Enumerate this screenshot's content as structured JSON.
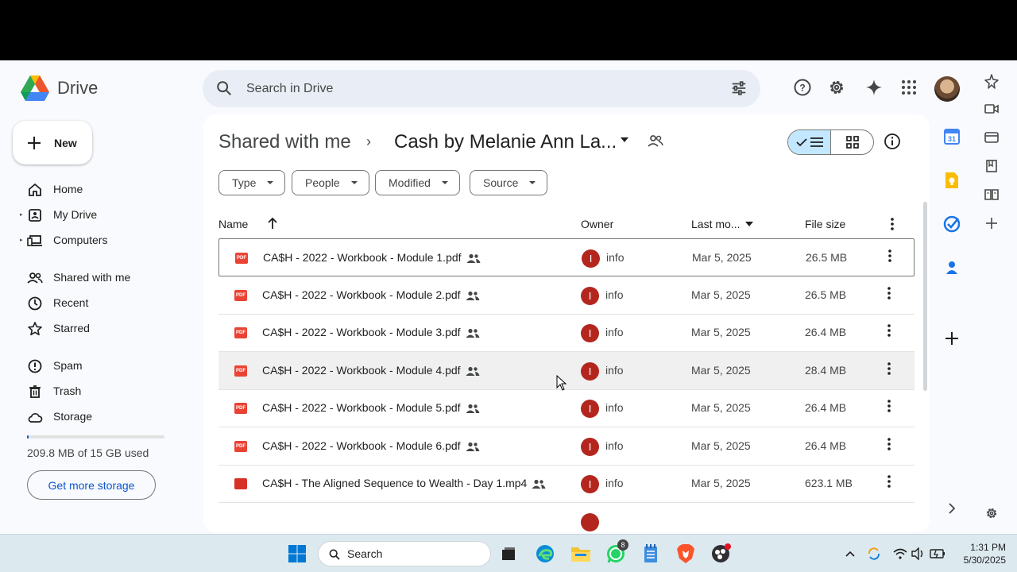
{
  "header": {
    "app_title": "Drive",
    "search_placeholder": "Search in Drive"
  },
  "sidebar": {
    "new_label": "New",
    "nav": [
      {
        "label": "Home"
      },
      {
        "label": "My Drive"
      },
      {
        "label": "Computers"
      },
      {
        "label": "Shared with me"
      },
      {
        "label": "Recent"
      },
      {
        "label": "Starred"
      },
      {
        "label": "Spam"
      },
      {
        "label": "Trash"
      },
      {
        "label": "Storage"
      }
    ],
    "storage_used_fraction": 0.014,
    "storage_text": "209.8 MB of 15 GB used",
    "get_more_storage": "Get more storage"
  },
  "main": {
    "breadcrumb_root": "Shared with me",
    "breadcrumb_folder": "Cash by Melanie Ann La...",
    "filters": [
      "Type",
      "People",
      "Modified",
      "Source"
    ],
    "columns": {
      "name": "Name",
      "owner": "Owner",
      "last_modified": "Last mo...",
      "file_size": "File size"
    },
    "files": [
      {
        "name": "CA$H - 2022 - Workbook - Module 1.pdf",
        "type": "pdf",
        "owner_initial": "I",
        "owner": "info",
        "modified": "Mar 5, 2025",
        "size": "26.5 MB"
      },
      {
        "name": "CA$H - 2022 - Workbook - Module 2.pdf",
        "type": "pdf",
        "owner_initial": "I",
        "owner": "info",
        "modified": "Mar 5, 2025",
        "size": "26.5 MB"
      },
      {
        "name": "CA$H - 2022 - Workbook - Module 3.pdf",
        "type": "pdf",
        "owner_initial": "I",
        "owner": "info",
        "modified": "Mar 5, 2025",
        "size": "26.4 MB"
      },
      {
        "name": "CA$H - 2022 - Workbook - Module 4.pdf",
        "type": "pdf",
        "owner_initial": "I",
        "owner": "info",
        "modified": "Mar 5, 2025",
        "size": "28.4 MB"
      },
      {
        "name": "CA$H - 2022 - Workbook - Module 5.pdf",
        "type": "pdf",
        "owner_initial": "I",
        "owner": "info",
        "modified": "Mar 5, 2025",
        "size": "26.4 MB"
      },
      {
        "name": "CA$H - 2022 - Workbook - Module 6.pdf",
        "type": "pdf",
        "owner_initial": "I",
        "owner": "info",
        "modified": "Mar 5, 2025",
        "size": "26.4 MB"
      },
      {
        "name": "CA$H - The Aligned Sequence to Wealth - Day 1.mp4",
        "type": "video",
        "owner_initial": "I",
        "owner": "info",
        "modified": "Mar 5, 2025",
        "size": "623.1 MB"
      }
    ]
  },
  "taskbar": {
    "search_label": "Search",
    "whatsapp_badge": "8",
    "time": "1:31 PM",
    "date": "5/30/2025"
  },
  "colors": {
    "accent": "#0b57d0",
    "pdf_red": "#ea4335",
    "video_red": "#d93025",
    "owner_avatar": "#b3261e",
    "selected_view": "#c2e7ff"
  }
}
